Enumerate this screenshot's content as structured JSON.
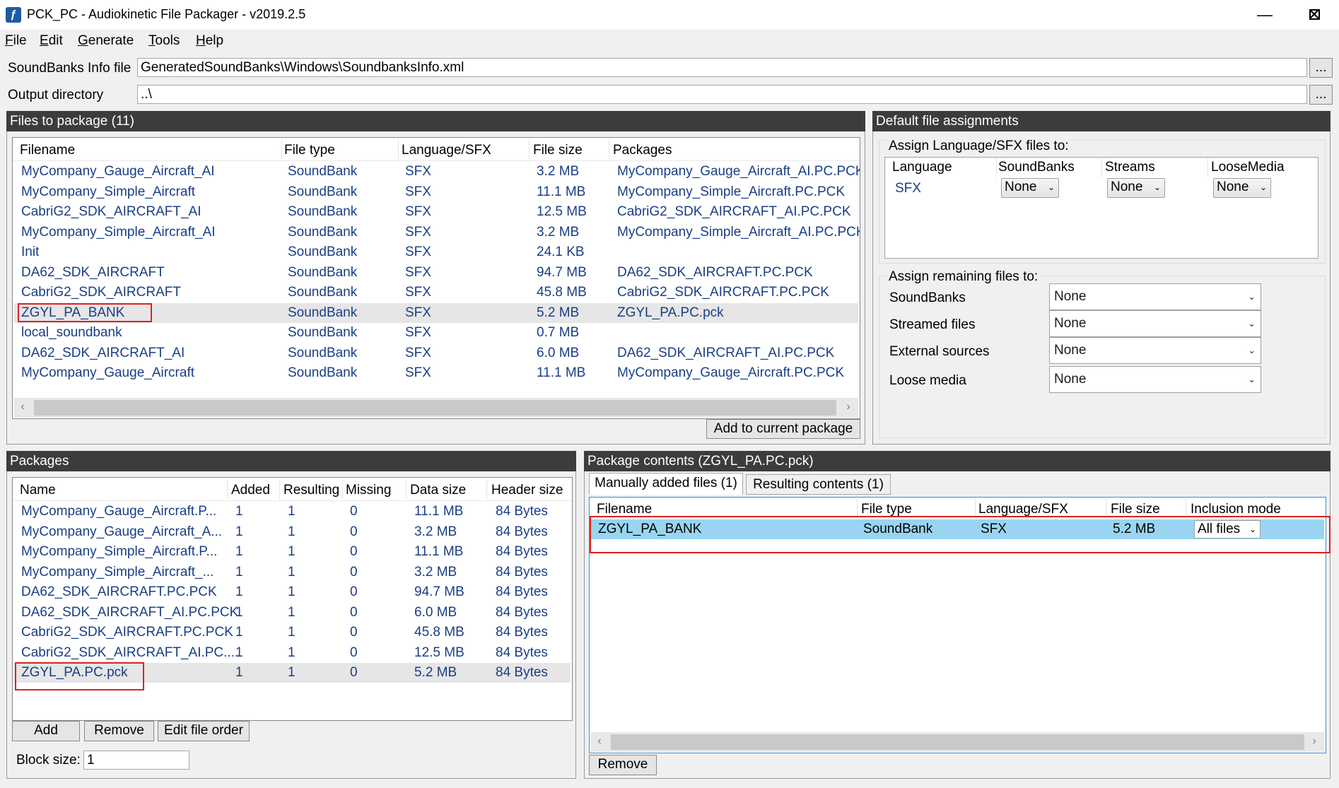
{
  "window": {
    "title": "PCK_PC - Audiokinetic File Packager - v2019.2.5",
    "minimize_glyph": "—",
    "maximize_glyph": "☐",
    "close_glyph": "✕"
  },
  "menu": [
    "File",
    "Edit",
    "Generate",
    "Tools",
    "Help"
  ],
  "menu_hotkeys": [
    "F",
    "E",
    "G",
    "T",
    "H"
  ],
  "soundbanks_info": {
    "label": "SoundBanks Info file",
    "value": "GeneratedSoundBanks\\Windows\\SoundbanksInfo.xml",
    "browse": "..."
  },
  "output_dir": {
    "label": "Output directory",
    "value": "..\\",
    "browse": "..."
  },
  "files_panel": {
    "title": "Files to package (11)",
    "columns": [
      "Filename",
      "File type",
      "Language/SFX",
      "File size",
      "Packages"
    ],
    "rows": [
      [
        "MyCompany_Gauge_Aircraft_AI",
        "SoundBank",
        "SFX",
        "3.2 MB",
        "MyCompany_Gauge_Aircraft_AI.PC.PCK"
      ],
      [
        "MyCompany_Simple_Aircraft",
        "SoundBank",
        "SFX",
        "11.1 MB",
        "MyCompany_Simple_Aircraft.PC.PCK"
      ],
      [
        "CabriG2_SDK_AIRCRAFT_AI",
        "SoundBank",
        "SFX",
        "12.5 MB",
        "CabriG2_SDK_AIRCRAFT_AI.PC.PCK"
      ],
      [
        "MyCompany_Simple_Aircraft_AI",
        "SoundBank",
        "SFX",
        "3.2 MB",
        "MyCompany_Simple_Aircraft_AI.PC.PCK"
      ],
      [
        "Init",
        "SoundBank",
        "SFX",
        "24.1 KB",
        ""
      ],
      [
        "DA62_SDK_AIRCRAFT",
        "SoundBank",
        "SFX",
        "94.7 MB",
        "DA62_SDK_AIRCRAFT.PC.PCK"
      ],
      [
        "CabriG2_SDK_AIRCRAFT",
        "SoundBank",
        "SFX",
        "45.8 MB",
        "CabriG2_SDK_AIRCRAFT.PC.PCK"
      ],
      [
        "ZGYL_PA_BANK",
        "SoundBank",
        "SFX",
        "5.2 MB",
        "ZGYL_PA.PC.pck"
      ],
      [
        "local_soundbank",
        "SoundBank",
        "SFX",
        "0.7 MB",
        ""
      ],
      [
        "DA62_SDK_AIRCRAFT_AI",
        "SoundBank",
        "SFX",
        "6.0 MB",
        "DA62_SDK_AIRCRAFT_AI.PC.PCK"
      ],
      [
        "MyCompany_Gauge_Aircraft",
        "SoundBank",
        "SFX",
        "11.1 MB",
        "MyCompany_Gauge_Aircraft.PC.PCK"
      ]
    ],
    "add_button": "Add to current package"
  },
  "defaults_panel": {
    "title": "Default file assignments",
    "assign_lang_label": "Assign Language/SFX files to:",
    "lang_columns": [
      "Language",
      "SoundBanks",
      "Streams",
      "LooseMedia"
    ],
    "lang_row": {
      "language": "SFX",
      "soundbanks": "None",
      "streams": "None",
      "loose": "None"
    },
    "assign_remaining_label": "Assign remaining files to:",
    "remaining": [
      {
        "label": "SoundBanks",
        "value": "None"
      },
      {
        "label": "Streamed files",
        "value": "None"
      },
      {
        "label": "External sources",
        "value": "None"
      },
      {
        "label": "Loose media",
        "value": "None"
      }
    ]
  },
  "packages_panel": {
    "title": "Packages",
    "columns": [
      "Name",
      "Added",
      "Resulting",
      "Missing",
      "Data size",
      "Header size"
    ],
    "rows": [
      [
        "MyCompany_Gauge_Aircraft.P...",
        "1",
        "1",
        "0",
        "11.1 MB",
        "84 Bytes"
      ],
      [
        "MyCompany_Gauge_Aircraft_A...",
        "1",
        "1",
        "0",
        "3.2 MB",
        "84 Bytes"
      ],
      [
        "MyCompany_Simple_Aircraft.P...",
        "1",
        "1",
        "0",
        "11.1 MB",
        "84 Bytes"
      ],
      [
        "MyCompany_Simple_Aircraft_...",
        "1",
        "1",
        "0",
        "3.2 MB",
        "84 Bytes"
      ],
      [
        "DA62_SDK_AIRCRAFT.PC.PCK",
        "1",
        "1",
        "0",
        "94.7 MB",
        "84 Bytes"
      ],
      [
        "DA62_SDK_AIRCRAFT_AI.PC.PCK",
        "1",
        "1",
        "0",
        "6.0 MB",
        "84 Bytes"
      ],
      [
        "CabriG2_SDK_AIRCRAFT.PC.PCK",
        "1",
        "1",
        "0",
        "45.8 MB",
        "84 Bytes"
      ],
      [
        "CabriG2_SDK_AIRCRAFT_AI.PC....",
        "1",
        "1",
        "0",
        "12.5 MB",
        "84 Bytes"
      ],
      [
        "ZGYL_PA.PC.pck",
        "1",
        "1",
        "0",
        "5.2 MB",
        "84 Bytes"
      ]
    ],
    "add": "Add",
    "remove": "Remove",
    "edit_order": "Edit file order",
    "block_size_label": "Block size:",
    "block_size_value": "1"
  },
  "contents_panel": {
    "title": "Package contents (ZGYL_PA.PC.pck)",
    "tabs": [
      "Manually added files (1)",
      "Resulting contents (1)"
    ],
    "columns": [
      "Filename",
      "File type",
      "Language/SFX",
      "File size",
      "Inclusion mode"
    ],
    "row": {
      "filename": "ZGYL_PA_BANK",
      "type": "SoundBank",
      "lang": "SFX",
      "size": "5.2 MB",
      "mode": "All files"
    },
    "remove": "Remove"
  },
  "glyphs": {
    "chevron": "⌄",
    "left": "‹",
    "right": "›"
  },
  "colors": {
    "panel_header": "#3c3c3c",
    "row_text": "#1a3e86",
    "selection_blue": "#99d5f2",
    "highlight_red": "#e02020"
  }
}
